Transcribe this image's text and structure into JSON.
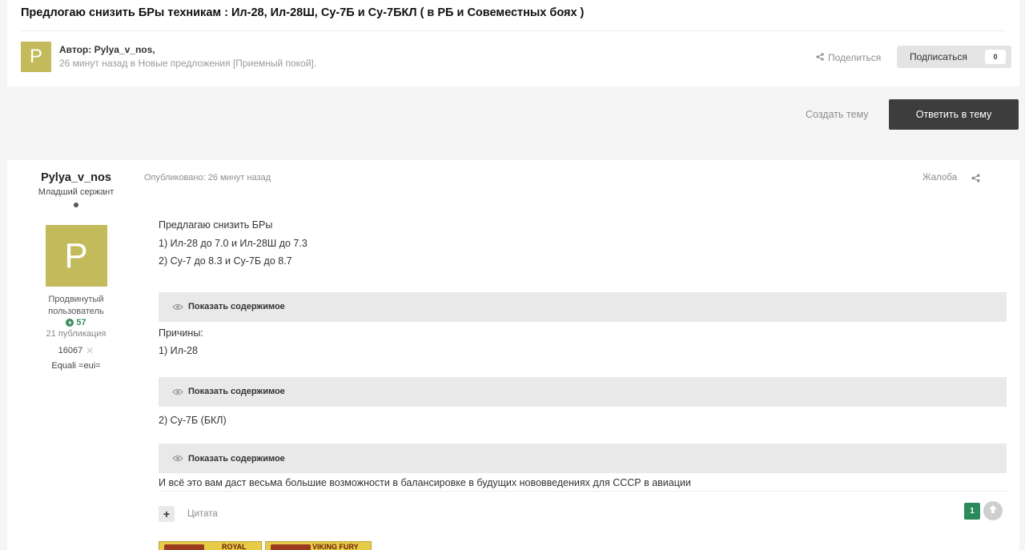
{
  "topic": {
    "title": "Предлогаю снизить БРы техникам : Ил-28, Ил-28Ш, Су-7Б и Су-7БКЛ ( в РБ и Совеместных боях )",
    "author_initial": "P",
    "author_line": "Автор: Pylya_v_nos,",
    "meta": "26 минут назад в Новые предложения [Приемный покой].",
    "share_label": "Поделиться",
    "follow_label": "Подписаться",
    "follow_count": "0"
  },
  "actions": {
    "create_topic": "Создать тему",
    "reply": "Ответить в тему"
  },
  "post": {
    "author": {
      "name": "Pylya_v_nos",
      "rank": "Младший сержант",
      "initial": "P",
      "group": "Продвинутый пользователь",
      "reputation": "57",
      "posts": "21 публикация",
      "battles": "16067",
      "signature": "Equali =eui="
    },
    "date": "Опубликовано: 26 минут назад",
    "report": "Жалоба",
    "lines": {
      "l1": "Предлагаю снизить БРы",
      "l2": "1) Ил-28 до 7.0 и Ил-28Ш до 7.3",
      "l3": "2) Су-7 до 8.3 и  Су-7Б до 8.7",
      "l4": "Причины:",
      "l5": "1) Ил-28",
      "l6": "2) Су-7Б (БКЛ)",
      "l7": "И всё это вам даст весьма большие возможности в балансировке в будущих нововведениях для СССР в авиации"
    },
    "spoiler_label": "Показать содержимое",
    "quote_label": "Цитата",
    "plus_label": "+",
    "likes": "1",
    "badges": [
      "ROYAL",
      "VIKING FURY"
    ]
  },
  "colors": {
    "avatar": "#c3bb5b",
    "reply_button": "#3d3d3d",
    "reputation": "#3b8b5a",
    "like_badge": "#2b8a5c"
  }
}
